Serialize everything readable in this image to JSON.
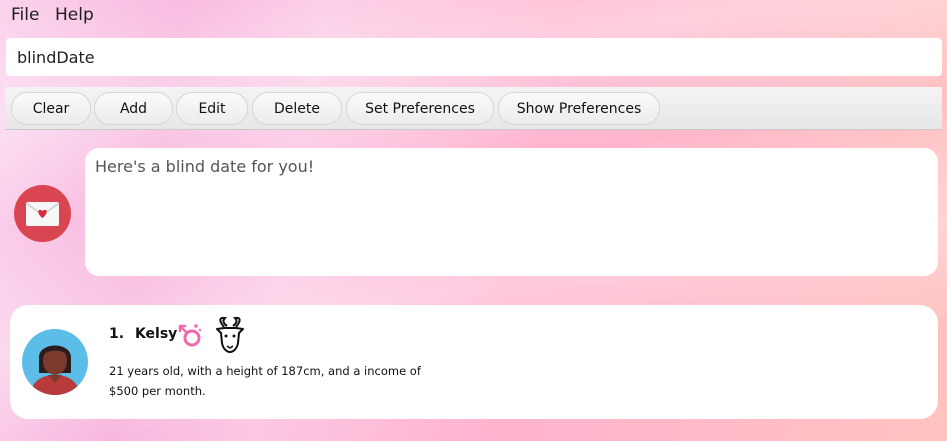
{
  "menu": {
    "file": "File",
    "help": "Help"
  },
  "command": {
    "value": "blindDate"
  },
  "toolbar": {
    "clear": "Clear",
    "add": "Add",
    "edit": "Edit",
    "delete": "Delete",
    "set_preferences": "Set Preferences",
    "show_preferences": "Show Preferences"
  },
  "response": {
    "text": "Here's a blind date for you!",
    "avatar_icon": "love-letter-icon"
  },
  "person": {
    "index": "1.",
    "name": "Kelsy",
    "gender_icon": "female-gender-icon",
    "zodiac_icon": "capricorn-goat-icon",
    "description": "21 years old, with a height of 187cm, and a income of $500 per month."
  },
  "colors": {
    "bot_avatar": "#d94550",
    "avatar_bg": "#5bbde8",
    "gender_icon": "#f06aae"
  }
}
